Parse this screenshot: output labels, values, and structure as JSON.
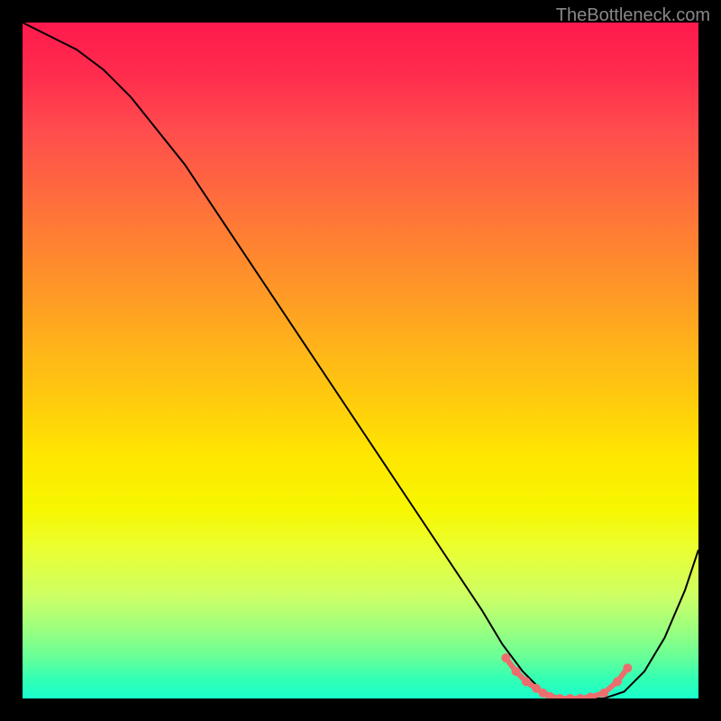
{
  "watermark": "TheBottleneck.com",
  "chart_data": {
    "type": "line",
    "title": "",
    "xlabel": "",
    "ylabel": "",
    "xlim": [
      0,
      100
    ],
    "ylim": [
      0,
      100
    ],
    "grid": false,
    "series": [
      {
        "name": "bottleneck-curve",
        "x": [
          0,
          4,
          8,
          12,
          16,
          20,
          24,
          28,
          32,
          36,
          40,
          44,
          48,
          52,
          56,
          60,
          64,
          68,
          71,
          74,
          77,
          80,
          83,
          86,
          89,
          92,
          95,
          98,
          100
        ],
        "values": [
          100,
          98,
          96,
          93,
          89,
          84,
          79,
          73,
          67,
          61,
          55,
          49,
          43,
          37,
          31,
          25,
          19,
          13,
          8,
          4,
          1,
          0,
          0,
          0,
          1,
          4,
          9,
          16,
          22
        ]
      }
    ],
    "marker_cluster": {
      "name": "optimal-range-dots",
      "points_x": [
        71.5,
        73.0,
        74.5,
        76.0,
        77.0,
        78.0,
        79.5,
        81.0,
        82.5,
        84.0,
        86.0,
        88.0,
        89.5
      ],
      "points_y": [
        6.0,
        4.0,
        2.5,
        1.5,
        0.8,
        0.3,
        0.0,
        0.0,
        0.0,
        0.2,
        0.8,
        2.5,
        4.5
      ]
    },
    "background_gradient": {
      "top": "#ff1a4d",
      "mid": "#ffe600",
      "bottom": "#1affcc"
    }
  }
}
